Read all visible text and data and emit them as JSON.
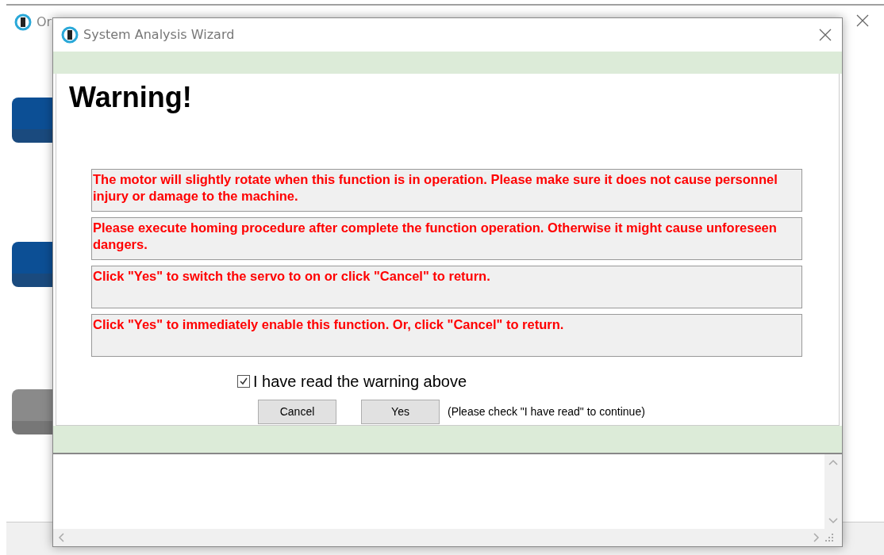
{
  "background_window": {
    "title": "Or"
  },
  "dialog": {
    "title": "System Analysis Wizard",
    "heading": "Warning!",
    "messages": [
      "The motor will slightly rotate when this function is in operation. Please make sure it does not cause personnel injury or damage to the machine.",
      "Please execute homing procedure after complete the function operation. Otherwise it might cause unforeseen dangers.",
      "Click \"Yes\" to switch the servo to on or click \"Cancel\" to return.",
      "Click \"Yes\" to immediately enable this function. Or, click \"Cancel\" to return."
    ],
    "confirm": {
      "label": "I have read the warning above",
      "checked": true
    },
    "buttons": [
      "Cancel",
      "Yes"
    ],
    "hint": "(Please check \"I have read\" to continue)"
  }
}
